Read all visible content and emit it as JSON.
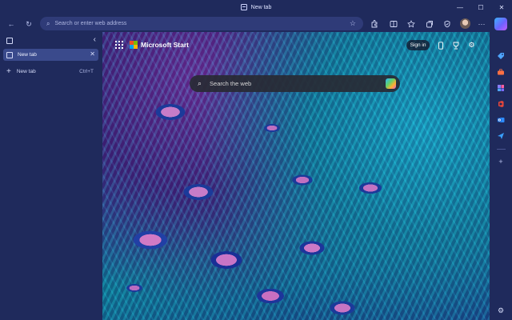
{
  "window": {
    "title": "New tab",
    "controls": {
      "minimize": "—",
      "maximize": "☐",
      "close": "✕"
    }
  },
  "toolbar": {
    "back": "←",
    "refresh": "↻",
    "address_placeholder": "Search or enter web address",
    "favorite_star": "☆",
    "icons": [
      "extensions-icon",
      "split-screen-icon",
      "favorites-icon",
      "collections-icon",
      "browser-essentials-icon",
      "profile-icon",
      "more-icon",
      "copilot-icon"
    ]
  },
  "tab_pane": {
    "tabs": [
      {
        "label": "New tab",
        "close": "✕"
      }
    ],
    "new_tab": {
      "plus": "+",
      "label": "New tab",
      "shortcut": "Ctrl+T"
    },
    "collapse": "‹"
  },
  "new_tab_page": {
    "brand": "Microsoft Start",
    "sign_in": "Sign in",
    "search_placeholder": "Search the web",
    "search_icon": "⌕"
  },
  "sidebar": {
    "icons": [
      "shopping-tag-icon",
      "toolbox-icon",
      "games-icon",
      "office-icon",
      "outlook-icon",
      "send-icon",
      "add-icon",
      "settings-icon"
    ],
    "colors": {
      "shopping": "#4ea5ff",
      "tools": "#ff7043",
      "games": "#8a7cff",
      "office": "#e9473a",
      "outlook": "#2f8cff",
      "send": "#3aa0ff"
    }
  },
  "colors": {
    "frame": "#1f2a5c",
    "active_tab": "#3a4a8c",
    "omnibox": "#2f3b78"
  }
}
